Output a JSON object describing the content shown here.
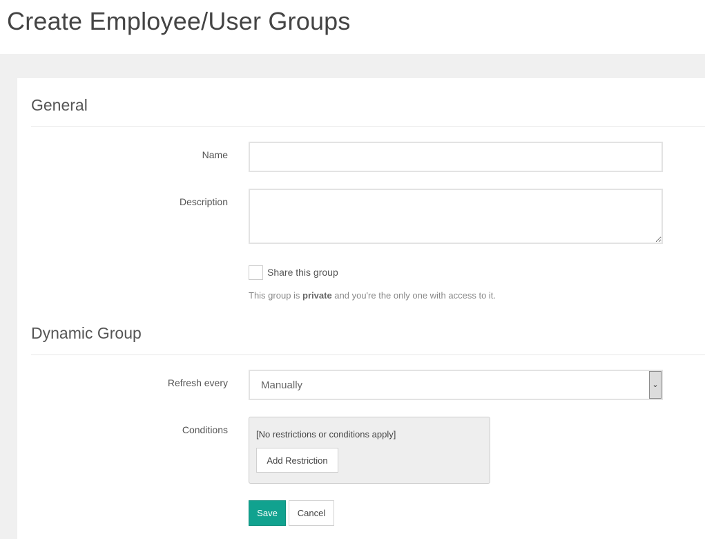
{
  "page": {
    "title": "Create Employee/User Groups"
  },
  "general": {
    "heading": "General",
    "name_label": "Name",
    "name_value": "",
    "description_label": "Description",
    "description_value": "",
    "share_label": "Share this group",
    "share_checked": false,
    "help_prefix": "This group is ",
    "help_bold": "private",
    "help_suffix": " and you're the only one with access to it."
  },
  "dynamic_group": {
    "heading": "Dynamic Group",
    "refresh_label": "Refresh every",
    "refresh_selected": "Manually",
    "conditions_label": "Conditions",
    "conditions_text": "[No restrictions or conditions apply]",
    "add_restriction_label": "Add Restriction"
  },
  "actions": {
    "save_label": "Save",
    "cancel_label": "Cancel"
  },
  "colors": {
    "primary_button": "#11a28f",
    "canvas_background": "#f0f0f0"
  }
}
